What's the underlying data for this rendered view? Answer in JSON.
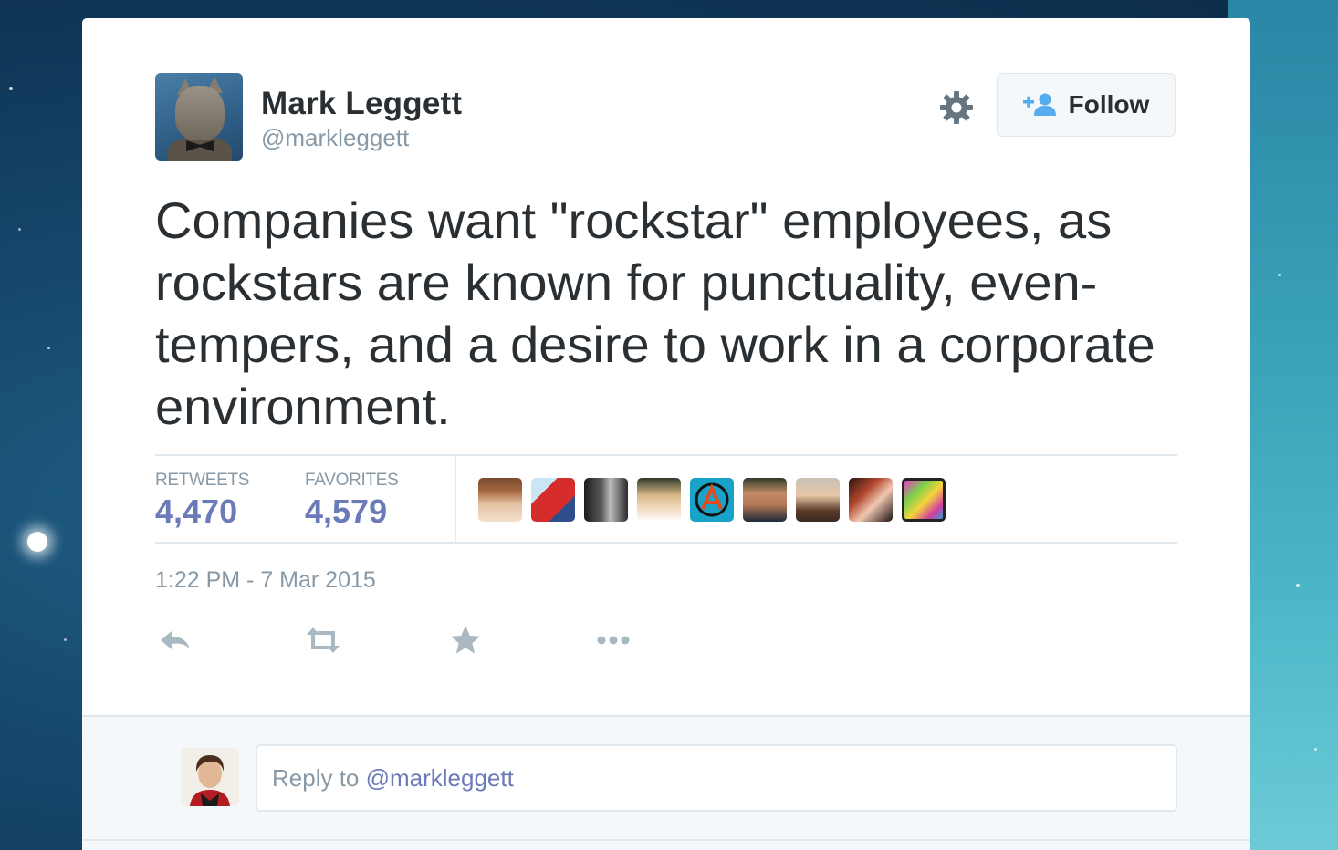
{
  "colors": {
    "accent": "#55acee",
    "text": "#292f33",
    "muted": "#8899a6",
    "count": "#6b7bb8"
  },
  "tweet": {
    "author_name": "Mark Leggett",
    "author_handle": "@markleggett",
    "follow_label": "Follow",
    "text": "Companies want \"rockstar\" employees, as rockstars are known for punctuality, even-tempers, and a desire to work in a corporate environment.",
    "stats": {
      "retweets_label": "RETWEETS",
      "retweets_value": "4,470",
      "favorites_label": "FAVORITES",
      "favorites_value": "4,579"
    },
    "favoriter_avatars": [
      "avatar-1",
      "avatar-2",
      "avatar-3",
      "avatar-4",
      "avatar-5",
      "avatar-6",
      "avatar-7",
      "avatar-8",
      "avatar-9"
    ],
    "timestamp": "1:22 PM - 7 Mar 2015"
  },
  "actions": [
    {
      "icon": "reply-icon"
    },
    {
      "icon": "retweet-icon"
    },
    {
      "icon": "favorite-star-icon"
    },
    {
      "icon": "more-icon"
    }
  ],
  "reply_box": {
    "prefix": "Reply to ",
    "handle": "@markleggett"
  }
}
